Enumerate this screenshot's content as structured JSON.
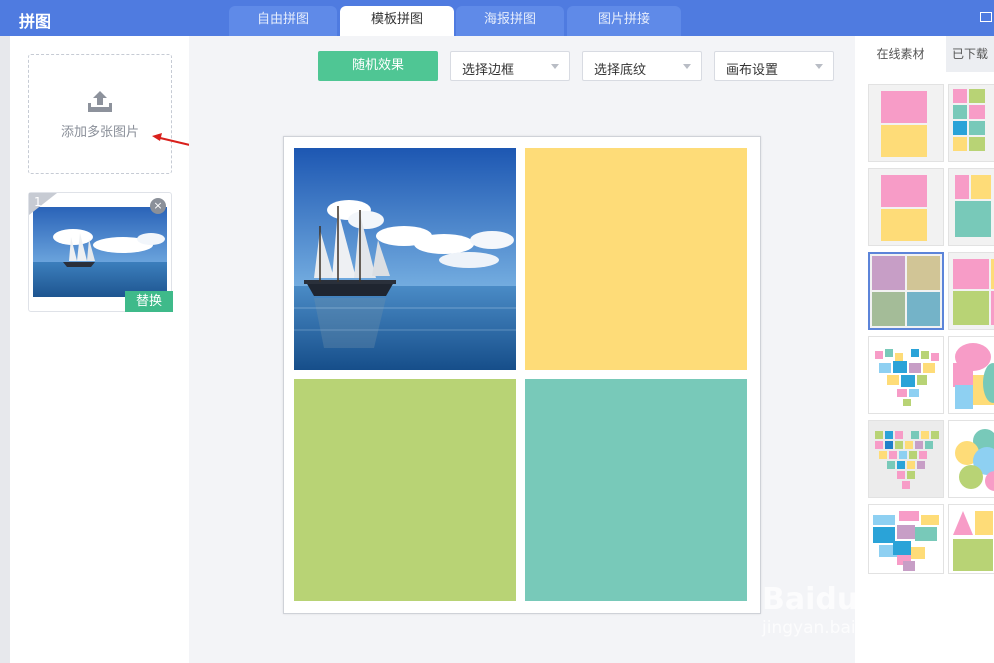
{
  "app": {
    "title": "拼图"
  },
  "tabs": [
    {
      "label": "自由拼图"
    },
    {
      "label": "模板拼图"
    },
    {
      "label": "海报拼图"
    },
    {
      "label": "图片拼接"
    }
  ],
  "left": {
    "upload_label": "添加多张图片",
    "thumb_index": "1",
    "thumb_close": "×",
    "replace_label": "替换"
  },
  "toolbar": {
    "random_label": "随机效果",
    "border_label": "选择边框",
    "texture_label": "选择底纹",
    "canvas_label": "画布设置"
  },
  "right": {
    "tab_online": "在线素材",
    "tab_downloaded": "已下载"
  },
  "colors": {
    "accent": "#4fc694",
    "titlebar": "#4f7be0",
    "yellow": "#fedc78",
    "green": "#b8d375",
    "teal": "#78c9b9",
    "pink": "#f79cc7",
    "selected": "#5c84d9"
  },
  "watermark": {
    "main": "Baidu 经验",
    "sub": "jingyan.baidu.com"
  }
}
